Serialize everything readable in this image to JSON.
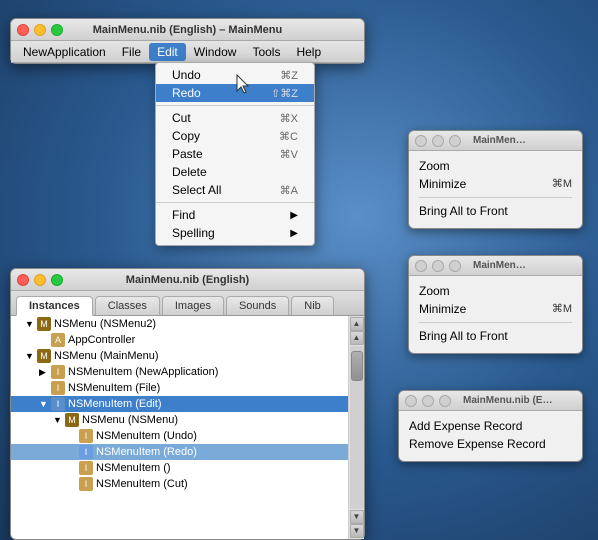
{
  "mainWindow": {
    "title": "MainMenu.nib (English) – MainMenu",
    "menuItems": [
      "NewApplication",
      "File",
      "Edit",
      "Window",
      "Tools",
      "Help"
    ]
  },
  "editMenu": {
    "items": [
      {
        "label": "Undo",
        "shortcut": "⌘Z"
      },
      {
        "label": "Redo",
        "shortcut": "⇧⌘Z"
      },
      {
        "label": "Cut",
        "shortcut": "⌘X"
      },
      {
        "label": "Copy",
        "shortcut": "⌘C"
      },
      {
        "label": "Paste",
        "shortcut": "⌘V"
      },
      {
        "label": "Delete",
        "shortcut": ""
      },
      {
        "label": "Select All",
        "shortcut": "⌘A"
      },
      {
        "label": "Find",
        "hasArrow": true
      },
      {
        "label": "Spelling",
        "hasArrow": true
      }
    ]
  },
  "instancesPanel": {
    "title": "MainMenu.nib (English)",
    "tabs": [
      "Instances",
      "Classes",
      "Images",
      "Sounds",
      "Nib"
    ],
    "treeItems": [
      {
        "indent": 0,
        "expanded": true,
        "label": "NSMenu (NSMenu2)",
        "type": "menu"
      },
      {
        "indent": 1,
        "label": "AppController",
        "type": "item"
      },
      {
        "indent": 0,
        "expanded": true,
        "label": "NSMenu (MainMenu)",
        "type": "menu"
      },
      {
        "indent": 1,
        "expanded": true,
        "label": "NSMenuItem (NewApplication)",
        "type": "item"
      },
      {
        "indent": 1,
        "label": "NSMenuItem (File)",
        "type": "item"
      },
      {
        "indent": 1,
        "expanded": true,
        "label": "NSMenuItem (Edit)",
        "type": "item",
        "selected": true
      },
      {
        "indent": 2,
        "label": "NSMenu (NSMenu)",
        "type": "menu"
      },
      {
        "indent": 3,
        "label": "NSMenuItem (Undo)",
        "type": "item"
      },
      {
        "indent": 3,
        "label": "NSMenuItem (Redo)",
        "type": "item",
        "highlighted": true
      },
      {
        "indent": 3,
        "label": "NSMenuItem ()",
        "type": "item"
      },
      {
        "indent": 3,
        "label": "NSMenuItem (Cut)",
        "type": "item"
      }
    ]
  },
  "windowMenu1": {
    "title": "MainMen…",
    "items": [
      {
        "label": "Zoom"
      },
      {
        "label": "Minimize",
        "shortcut": "⌘M"
      },
      {
        "label": "Bring All to Front"
      }
    ]
  },
  "windowMenu2": {
    "title": "MainMen…",
    "items": [
      {
        "label": "Zoom"
      },
      {
        "label": "Minimize",
        "shortcut": "⌘M"
      },
      {
        "label": "Bring All to Front"
      }
    ]
  },
  "expenseWindow": {
    "title": "MainMenu.nib (E…",
    "items": [
      {
        "label": "Add Expense Record"
      },
      {
        "label": "Remove Expense Record"
      }
    ]
  }
}
